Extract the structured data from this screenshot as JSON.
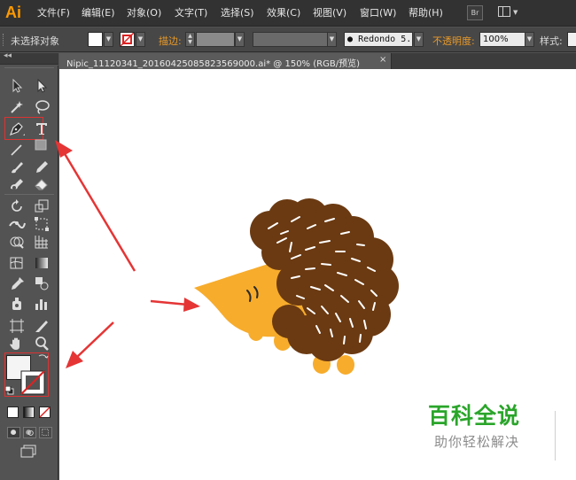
{
  "app": {
    "logo": "Ai"
  },
  "menubar": {
    "items": [
      "文件(F)",
      "编辑(E)",
      "对象(O)",
      "文字(T)",
      "选择(S)",
      "效果(C)",
      "视图(V)",
      "窗口(W)",
      "帮助(H)"
    ],
    "bridge_label": "Br"
  },
  "controlbar": {
    "selection_status": "未选择对象",
    "stroke_label": "描边:",
    "brush_value": "Redondo 5.",
    "opacity_label": "不透明度:",
    "opacity_value": "100%",
    "style_label": "样式:"
  },
  "document": {
    "tab_title": "Nipic_11120341_20160425085823569000.ai* @ 150% (RGB/预览)",
    "close_glyph": "×"
  },
  "watermark": {
    "title": "百科全说",
    "subtitle": "助你轻松解决"
  },
  "colors": {
    "accent_orange": "#ff9a00",
    "hedgehog_body": "#f7ac2c",
    "hedgehog_spines": "#6b3a12",
    "annotation_red": "#e53535",
    "watermark_green": "#2aa52a"
  }
}
